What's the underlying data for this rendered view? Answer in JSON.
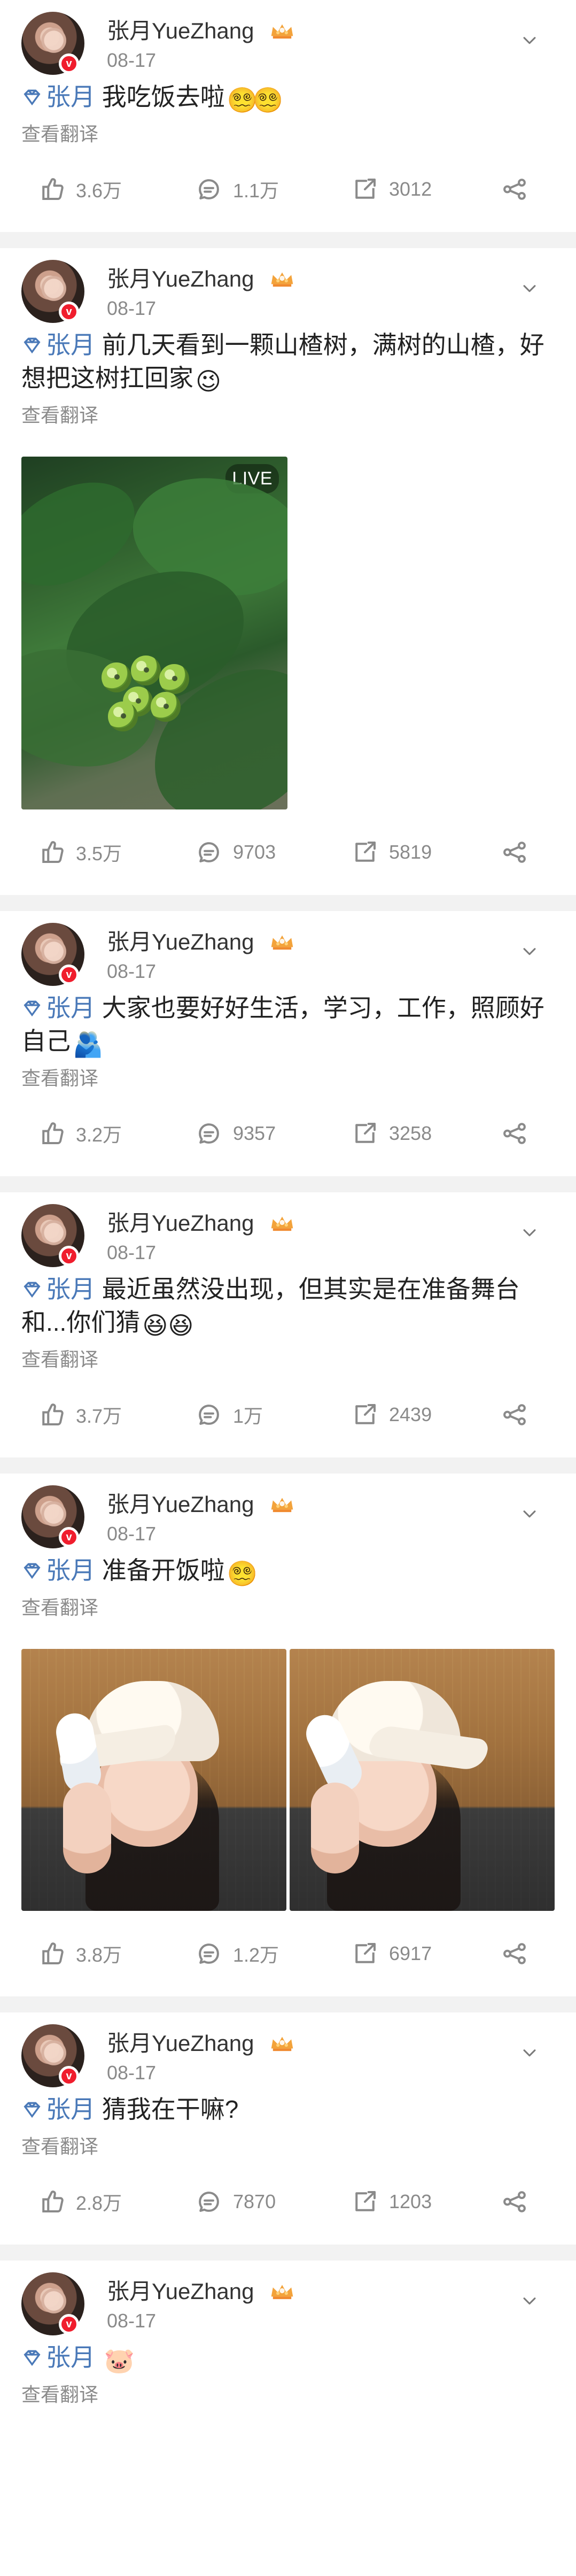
{
  "icons": {
    "vip": "diamond-icon",
    "verified": "verified-badge-icon",
    "crown": "crown-icon",
    "expand": "chevron-down-icon",
    "like": "like-icon",
    "comment": "comment-icon",
    "repost": "repost-icon",
    "share": "share-icon"
  },
  "colors": {
    "accent_blue": "#4a79b8",
    "badge_red": "#f01d2d",
    "muted_gray": "#8a8a8a",
    "separator": "#f2f2f2"
  },
  "feed": {
    "posts": [
      {
        "author": "张月YueZhang",
        "date": "08-17",
        "tag": "张月",
        "text": "我吃饭去啦",
        "emoji_1": "😵‍💫",
        "emoji_2": "😵‍💫",
        "translate": "查看翻译",
        "stats": {
          "likes": "3.6万",
          "comments": "1.1万",
          "reposts": "3012"
        }
      },
      {
        "author": "张月YueZhang",
        "date": "08-17",
        "tag": "张月",
        "text": "前几天看到一颗山楂树，满树的山楂，好想把这树扛回家",
        "emoji_1": "😉",
        "translate": "查看翻译",
        "media": {
          "live_label": "LIVE"
        },
        "stats": {
          "likes": "3.5万",
          "comments": "9703",
          "reposts": "5819"
        }
      },
      {
        "author": "张月YueZhang",
        "date": "08-17",
        "tag": "张月",
        "text": "大家也要好好生活，学习，工作，照顾好自己",
        "emoji_1": "🫂",
        "translate": "查看翻译",
        "stats": {
          "likes": "3.2万",
          "comments": "9357",
          "reposts": "3258"
        }
      },
      {
        "author": "张月YueZhang",
        "date": "08-17",
        "tag": "张月",
        "text": "最近虽然没出现，但其实是在准备舞台和...你们猜",
        "emoji_1": "😆",
        "emoji_2": "😆",
        "translate": "查看翻译",
        "stats": {
          "likes": "3.7万",
          "comments": "1万",
          "reposts": "2439"
        }
      },
      {
        "author": "张月YueZhang",
        "date": "08-17",
        "tag": "张月",
        "text": "准备开饭啦",
        "emoji_1": "😵‍💫",
        "translate": "查看翻译",
        "stats": {
          "likes": "3.8万",
          "comments": "1.2万",
          "reposts": "6917"
        }
      },
      {
        "author": "张月YueZhang",
        "date": "08-17",
        "tag": "张月",
        "text": "猜我在干嘛?",
        "translate": "查看翻译",
        "stats": {
          "likes": "2.8万",
          "comments": "7870",
          "reposts": "1203"
        }
      },
      {
        "author": "张月YueZhang",
        "date": "08-17",
        "tag": "张月",
        "text": "",
        "emoji_1": "🐷",
        "translate": "查看翻译"
      }
    ]
  }
}
